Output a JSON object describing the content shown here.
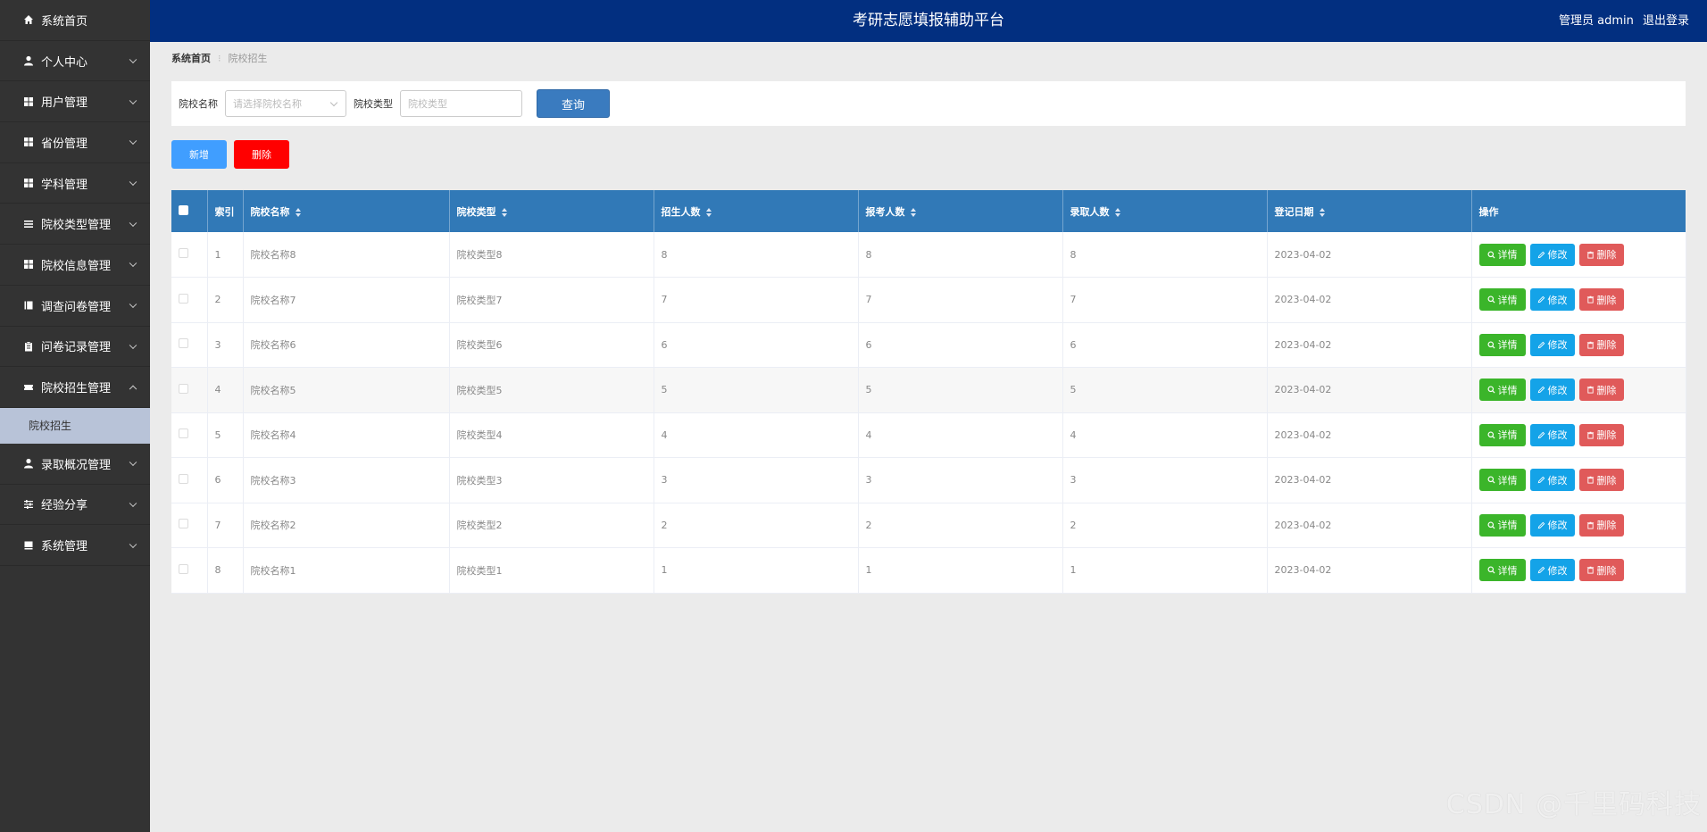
{
  "header": {
    "title": "考研志愿填报辅助平台",
    "user": "管理员 admin",
    "logout": "退出登录"
  },
  "sidebar": {
    "items": [
      {
        "label": "系统首页",
        "icon": "home-icon"
      },
      {
        "label": "个人中心",
        "icon": "person-icon"
      },
      {
        "label": "用户管理",
        "icon": "grid-icon"
      },
      {
        "label": "省份管理",
        "icon": "grid-icon"
      },
      {
        "label": "学科管理",
        "icon": "grid-icon"
      },
      {
        "label": "院校类型管理",
        "icon": "list-icon"
      },
      {
        "label": "院校信息管理",
        "icon": "grid-icon"
      },
      {
        "label": "调查问卷管理",
        "icon": "book-icon"
      },
      {
        "label": "问卷记录管理",
        "icon": "clipboard-icon"
      },
      {
        "label": "院校招生管理",
        "icon": "ticket-icon"
      },
      {
        "label": "录取概况管理",
        "icon": "person-icon"
      },
      {
        "label": "经验分享",
        "icon": "sliders-icon"
      },
      {
        "label": "系统管理",
        "icon": "book-icon"
      }
    ],
    "submenu": {
      "label": "院校招生"
    }
  },
  "breadcrumb": {
    "home": "系统首页",
    "current": "院校招生"
  },
  "search": {
    "school_name_label": "院校名称",
    "school_name_placeholder": "请选择院校名称",
    "school_type_label": "院校类型",
    "school_type_placeholder": "院校类型",
    "query_label": "查询"
  },
  "actions": {
    "add_label": "新增",
    "delete_label": "删除"
  },
  "table": {
    "headers": [
      "索引",
      "院校名称",
      "院校类型",
      "招生人数",
      "报考人数",
      "录取人数",
      "登记日期",
      "操作"
    ],
    "rows": [
      [
        "1",
        "院校名称8",
        "院校类型8",
        "8",
        "8",
        "8",
        "2023-04-02"
      ],
      [
        "2",
        "院校名称7",
        "院校类型7",
        "7",
        "7",
        "7",
        "2023-04-02"
      ],
      [
        "3",
        "院校名称6",
        "院校类型6",
        "6",
        "6",
        "6",
        "2023-04-02"
      ],
      [
        "4",
        "院校名称5",
        "院校类型5",
        "5",
        "5",
        "5",
        "2023-04-02"
      ],
      [
        "5",
        "院校名称4",
        "院校类型4",
        "4",
        "4",
        "4",
        "2023-04-02"
      ],
      [
        "6",
        "院校名称3",
        "院校类型3",
        "3",
        "3",
        "3",
        "2023-04-02"
      ],
      [
        "7",
        "院校名称2",
        "院校类型2",
        "2",
        "2",
        "2",
        "2023-04-02"
      ],
      [
        "8",
        "院校名称1",
        "院校类型1",
        "1",
        "1",
        "1",
        "2023-04-02"
      ]
    ],
    "row_actions": {
      "detail": "详情",
      "edit": "修改",
      "remove": "删除"
    }
  },
  "watermark": "CSDN @千里码科技",
  "colors": {
    "header_bg": "#022f80",
    "sidebar_bg": "#333333",
    "table_header_bg": "#3179b7",
    "add_btn": "#409eff",
    "delete_btn": "#ff0000",
    "detail_btn": "#3bb52a",
    "edit_btn": "#14a3e8",
    "remove_btn": "#e05a5a"
  }
}
